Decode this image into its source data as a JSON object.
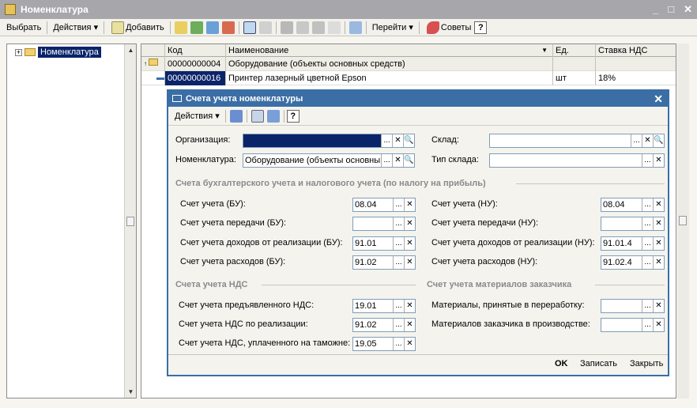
{
  "window": {
    "title": "Номенклатура"
  },
  "toolbar": {
    "select": "Выбрать",
    "actions": "Действия",
    "add": "Добавить",
    "goto": "Перейти",
    "tips": "Советы",
    "help": "?"
  },
  "tree": {
    "root": "Номенклатура"
  },
  "grid": {
    "columns": [
      "Код",
      "Наименование",
      "Ед.",
      "Ставка НДС"
    ],
    "rows": [
      {
        "code": "00000000004",
        "name": "Оборудование (объекты основных средств)",
        "unit": "",
        "vat": ""
      },
      {
        "code": "00000000016",
        "name": "Принтер лазерный цветной Epson",
        "unit": "шт",
        "vat": "18%"
      }
    ]
  },
  "dialog": {
    "title": "Счета учета номенклатуры",
    "actions": "Действия",
    "help": "?",
    "org_label": "Организация:",
    "org_value": "",
    "nom_label": "Номенклатура:",
    "nom_value": "Оборудование (объекты основны:",
    "warehouse_label": "Склад:",
    "warehouse_value": "",
    "whtype_label": "Тип склада:",
    "whtype_value": "",
    "group1": "Счета бухгалтерского учета и налогового учета (по налогу на прибыль)",
    "group2": "Счета учета НДС",
    "group3": "Счет учета материалов заказчика",
    "left_fields": [
      {
        "label": "Счет учета (БУ):",
        "value": "08.04"
      },
      {
        "label": "Счет учета передачи (БУ):",
        "value": ""
      },
      {
        "label": "Счет учета доходов от реализации (БУ):",
        "value": "91.01"
      },
      {
        "label": "Счет учета расходов (БУ):",
        "value": "91.02"
      }
    ],
    "right_fields": [
      {
        "label": "Счет учета (НУ):",
        "value": "08.04"
      },
      {
        "label": "Счет учета передачи (НУ):",
        "value": ""
      },
      {
        "label": "Счет учета доходов от реализации (НУ):",
        "value": "91.01.4"
      },
      {
        "label": "Счет учета расходов (НУ):",
        "value": "91.02.4"
      }
    ],
    "vat_fields": [
      {
        "label": "Счет учета предъявленного НДС:",
        "value": "19.01"
      },
      {
        "label": "Счет учета НДС по реализации:",
        "value": "91.02"
      },
      {
        "label": "Счет учета НДС, уплаченного на таможне:",
        "value": "19.05"
      }
    ],
    "material_fields": [
      {
        "label": "Материалы, принятые в переработку:",
        "value": ""
      },
      {
        "label": "Материалов заказчика в производстве:",
        "value": ""
      }
    ],
    "ok": "OK",
    "save": "Записать",
    "close": "Закрыть"
  }
}
